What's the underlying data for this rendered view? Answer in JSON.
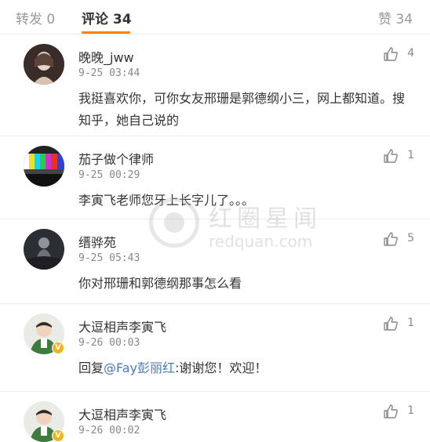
{
  "tabs": {
    "repost": "转发 0",
    "comment": "评论 34",
    "like": "赞 34"
  },
  "comments": [
    {
      "name": "晚晚_jww",
      "time": "9-25 03:44",
      "text": "我挺喜欢你，可你女友邢珊是郭德纲小三，网上都知道。搜知乎，她自己说的",
      "likes": "4"
    },
    {
      "name": "茄子做个律师",
      "time": "9-25 00:29",
      "text": "李寅飞老师您牙上长字儿了。。。",
      "likes": "1"
    },
    {
      "name": "缙骅苑",
      "time": "9-25 05:43",
      "text": "你对邢珊和郭德纲那事怎么看",
      "likes": "5"
    },
    {
      "name": "大逗相声李寅飞",
      "time": "9-26 00:03",
      "reply_prefix": "回复",
      "mention": "@Fay彭丽红",
      "text": ":谢谢您！欢迎！",
      "likes": "1"
    },
    {
      "name": "大逗相声李寅飞",
      "time": "9-26 00:02",
      "likes": "1"
    }
  ],
  "watermark": {
    "cn": "红圈星闻",
    "en": "redquan.com"
  },
  "icons": {
    "like": "thumbs-up-icon",
    "verified": "verified-badge-icon"
  },
  "colors": {
    "accent": "#ff8200",
    "mention": "#4a7ab4",
    "verified": "#f6b21a"
  }
}
